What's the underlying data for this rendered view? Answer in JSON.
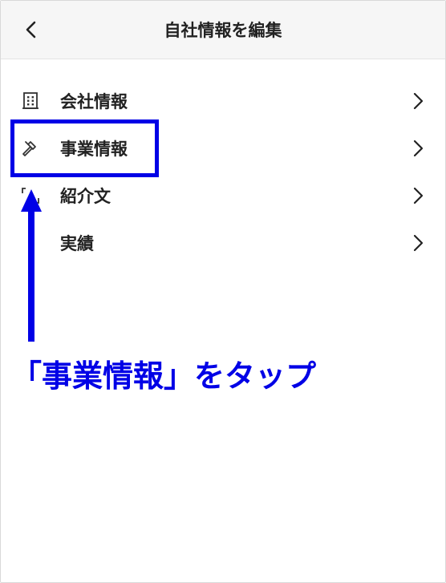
{
  "header": {
    "title": "自社情報を編集"
  },
  "menu": [
    {
      "label": "会社情報",
      "icon": "building-icon"
    },
    {
      "label": "事業情報",
      "icon": "hammer-icon"
    },
    {
      "label": "紹介文",
      "icon": "quote-brackets-icon"
    },
    {
      "label": "実績",
      "icon": ""
    }
  ],
  "annotation": {
    "text": "「事業情報」をタップ",
    "color": "#0000e6"
  }
}
